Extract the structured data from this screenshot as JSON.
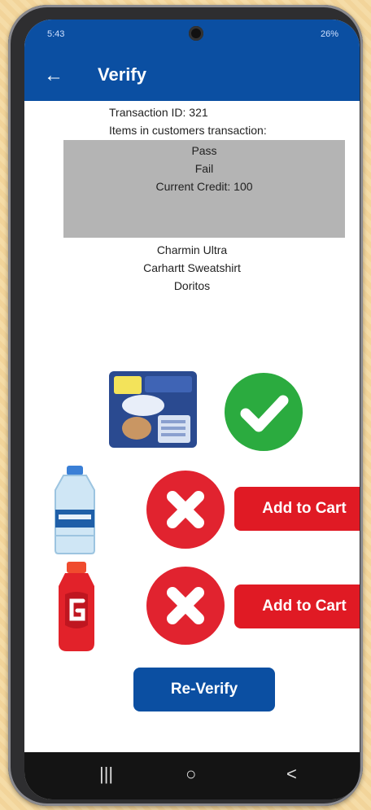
{
  "status_bar": {
    "time": "5:43",
    "battery": "26%"
  },
  "app_bar": {
    "back_glyph": "←",
    "title": "Verify"
  },
  "transaction": {
    "id_text": "Transaction ID: 321",
    "items_label": "Items in customers transaction:"
  },
  "panel": {
    "pass": "Pass",
    "fail": "Fail",
    "credit": "Current Credit: 100"
  },
  "item_names": [
    "Charmin Ultra",
    "Carhartt Sweatshirt",
    "Doritos"
  ],
  "verified_items": [
    {
      "product": "Charmin Ultra toilet paper",
      "status": "pass",
      "status_icon": "check-icon"
    },
    {
      "product": "water bottle",
      "status": "fail",
      "status_icon": "x-icon",
      "action": "Add to Cart"
    },
    {
      "product": "Gatorade bottle",
      "status": "fail",
      "status_icon": "x-icon",
      "action": "Add to Cart"
    }
  ],
  "reverify_label": "Re-Verify",
  "nav_bar": {
    "recents_glyph": "|||",
    "home_glyph": "○",
    "back_glyph": "<"
  },
  "colors": {
    "primary": "#0b4fa2",
    "pass": "#2bab3f",
    "fail": "#e1232f",
    "cart_button": "#e01a24",
    "panel": "#b4b4b4"
  }
}
